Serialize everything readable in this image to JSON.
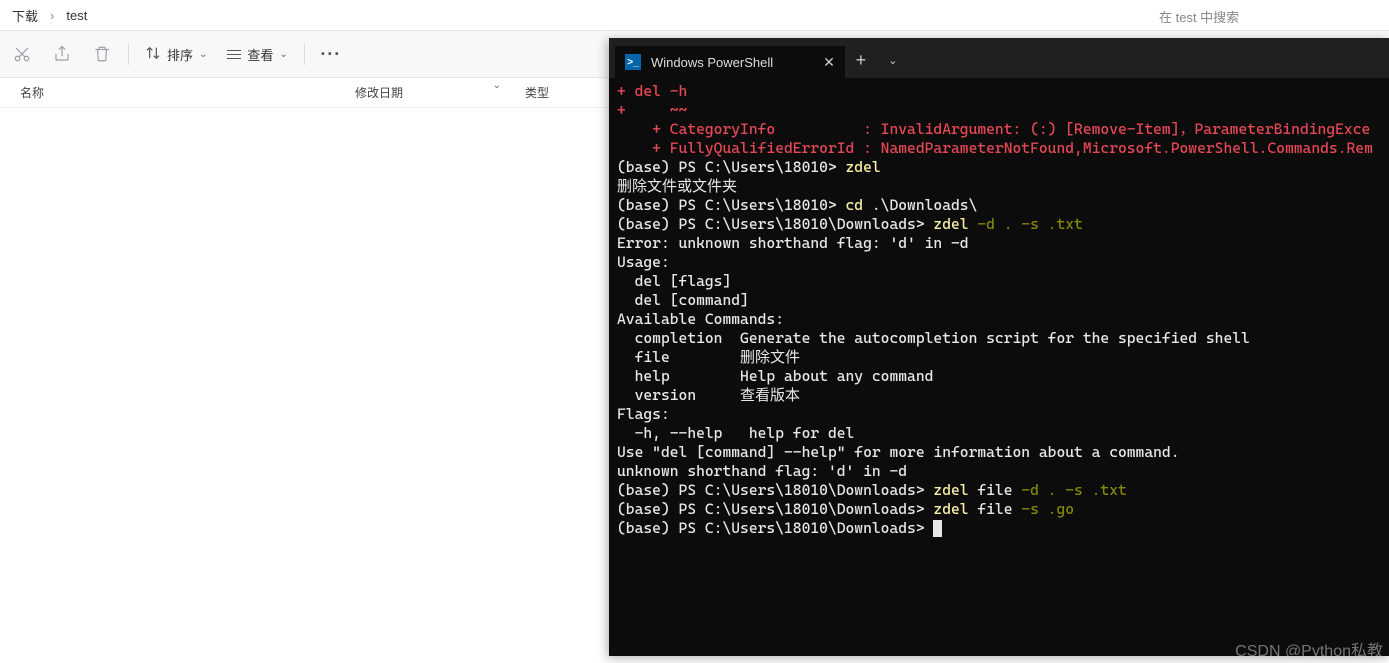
{
  "explorer": {
    "breadcrumb": [
      "下载",
      "test"
    ],
    "search_placeholder": "在 test 中搜索",
    "toolbar": {
      "sort_label": "排序",
      "view_label": "查看"
    },
    "columns": {
      "name": "名称",
      "modified": "修改日期",
      "type": "类型"
    }
  },
  "terminal": {
    "tab_title": "Windows PowerShell",
    "lines": [
      {
        "cls": "t-red",
        "text": "+ del -h"
      },
      {
        "cls": "t-red",
        "text": "+     ~~"
      },
      {
        "parts": [
          {
            "cls": "t-red",
            "text": "    + CategoryInfo          : "
          },
          {
            "cls": "t-red",
            "text": "InvalidArgument: (:) [Remove-Item]"
          },
          {
            "cls": "t-red",
            "text": "，ParameterBindingExce"
          }
        ]
      },
      {
        "parts": [
          {
            "cls": "t-red",
            "text": "    + FullyQualifiedErrorId : "
          },
          {
            "cls": "t-red",
            "text": "NamedParameterNotFound,Microsoft.PowerShell.Commands.Rem"
          }
        ]
      },
      {
        "cls": "",
        "text": ""
      },
      {
        "parts": [
          {
            "cls": "t-prompt",
            "text": "(base) PS C:\\Users\\18010> "
          },
          {
            "cls": "t-yellow",
            "text": "zdel"
          }
        ]
      },
      {
        "cls": "t-prompt",
        "text": "删除文件或文件夹"
      },
      {
        "parts": [
          {
            "cls": "t-prompt",
            "text": "(base) PS C:\\Users\\18010> "
          },
          {
            "cls": "t-yellow",
            "text": "cd"
          },
          {
            "cls": "t-prompt",
            "text": " .\\Downloads\\"
          }
        ]
      },
      {
        "parts": [
          {
            "cls": "t-prompt",
            "text": "(base) PS C:\\Users\\18010\\Downloads> "
          },
          {
            "cls": "t-yellow",
            "text": "zdel"
          },
          {
            "cls": "t-darkyellow",
            "text": " -d . -s .txt"
          }
        ]
      },
      {
        "cls": "t-prompt",
        "text": "Error: unknown shorthand flag: 'd' in -d"
      },
      {
        "cls": "t-prompt",
        "text": "Usage:"
      },
      {
        "cls": "t-prompt",
        "text": "  del [flags]"
      },
      {
        "cls": "t-prompt",
        "text": "  del [command]"
      },
      {
        "cls": "",
        "text": ""
      },
      {
        "cls": "t-prompt",
        "text": "Available Commands:"
      },
      {
        "cls": "t-prompt",
        "text": "  completion  Generate the autocompletion script for the specified shell"
      },
      {
        "cls": "t-prompt",
        "text": "  file        删除文件"
      },
      {
        "cls": "t-prompt",
        "text": "  help        Help about any command"
      },
      {
        "cls": "t-prompt",
        "text": "  version     查看版本"
      },
      {
        "cls": "",
        "text": ""
      },
      {
        "cls": "t-prompt",
        "text": "Flags:"
      },
      {
        "cls": "t-prompt",
        "text": "  -h, --help   help for del"
      },
      {
        "cls": "",
        "text": ""
      },
      {
        "cls": "t-prompt",
        "text": "Use \"del [command] --help\" for more information about a command."
      },
      {
        "cls": "",
        "text": ""
      },
      {
        "cls": "t-prompt",
        "text": "unknown shorthand flag: 'd' in -d"
      },
      {
        "parts": [
          {
            "cls": "t-prompt",
            "text": "(base) PS C:\\Users\\18010\\Downloads> "
          },
          {
            "cls": "t-yellow",
            "text": "zdel"
          },
          {
            "cls": "t-prompt",
            "text": " file "
          },
          {
            "cls": "t-darkyellow",
            "text": "-d . -s .txt"
          }
        ]
      },
      {
        "parts": [
          {
            "cls": "t-prompt",
            "text": "(base) PS C:\\Users\\18010\\Downloads> "
          },
          {
            "cls": "t-yellow",
            "text": "zdel"
          },
          {
            "cls": "t-prompt",
            "text": " file "
          },
          {
            "cls": "t-darkyellow",
            "text": "-s .go"
          }
        ]
      },
      {
        "parts": [
          {
            "cls": "t-prompt",
            "text": "(base) PS C:\\Users\\18010\\Downloads> "
          }
        ],
        "cursor": true
      }
    ]
  },
  "watermark": "CSDN @Python私教"
}
